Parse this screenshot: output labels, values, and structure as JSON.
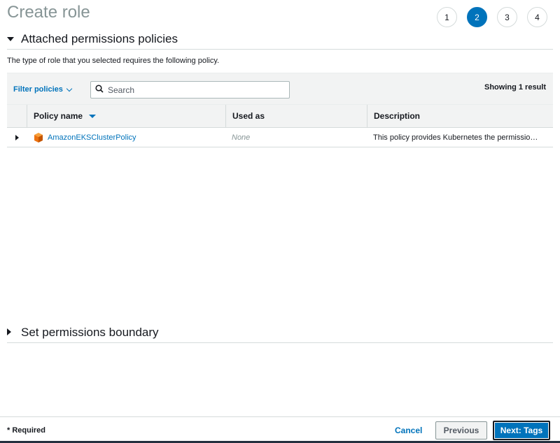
{
  "page": {
    "title": "Create role"
  },
  "steps": [
    "1",
    "2",
    "3",
    "4"
  ],
  "active_step": "2",
  "attached": {
    "header": "Attached permissions policies",
    "subtext": "The type of role that you selected requires the following policy.",
    "filter_label": "Filter policies",
    "search_placeholder": "Search",
    "showing": "Showing 1 result",
    "columns": {
      "name": "Policy name",
      "used_as": "Used as",
      "description": "Description"
    },
    "rows": [
      {
        "name": "AmazonEKSClusterPolicy",
        "used_as": "None",
        "description": "This policy provides Kubernetes the permissio…"
      }
    ]
  },
  "boundary": {
    "header": "Set permissions boundary"
  },
  "footer": {
    "required": "* Required",
    "cancel": "Cancel",
    "previous": "Previous",
    "next": "Next: Tags"
  },
  "colors": {
    "accent": "#0073bb",
    "policy_icon": "#ec7211"
  },
  "icons": {
    "policy": "aws-policy-cube-icon",
    "search": "search-icon"
  }
}
